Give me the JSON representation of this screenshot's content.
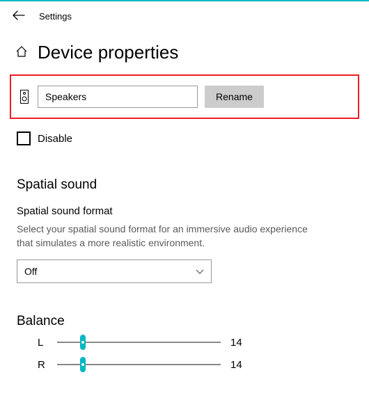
{
  "window": {
    "title": "Settings"
  },
  "page": {
    "heading": "Device properties"
  },
  "device": {
    "name": "Speakers",
    "rename_label": "Rename",
    "disable_label": "Disable",
    "disabled": false
  },
  "spatial": {
    "section_title": "Spatial sound",
    "format_label": "Spatial sound format",
    "help_text": "Select your spatial sound format for an immersive audio experience that simulates a more realistic environment.",
    "selected": "Off"
  },
  "balance": {
    "title": "Balance",
    "left_label": "L",
    "right_label": "R",
    "left_value": "14",
    "right_value": "14"
  },
  "colors": {
    "accent": "#00b7c3",
    "highlight": "#ed1c24"
  }
}
